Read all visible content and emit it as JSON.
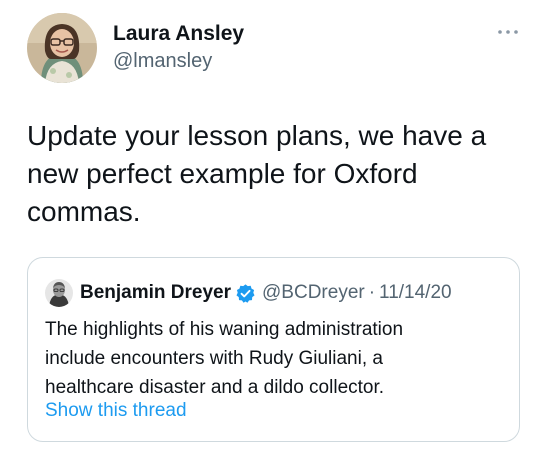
{
  "author": {
    "name": "Laura Ansley",
    "handle": "@lmansley"
  },
  "tweet": {
    "text": "Update your lesson plans, we have a\nnew perfect example for Oxford\ncommas."
  },
  "quoted_tweet": {
    "name": "Benjamin Dreyer",
    "verified": true,
    "handle": "@BCDreyer",
    "separator": "·",
    "date": "11/14/20",
    "text": "The highlights of his waning administration\ninclude encounters with Rudy Giuliani, a\nhealthcare disaster and a dildo collector.",
    "show_thread_label": "Show this thread"
  },
  "icons": {
    "more": "more-horizontal-icon",
    "verified": "verified-badge-icon"
  },
  "colors": {
    "text": "#0f1419",
    "secondary": "#536471",
    "link": "#1d9bf0",
    "border": "#cfd9de"
  }
}
